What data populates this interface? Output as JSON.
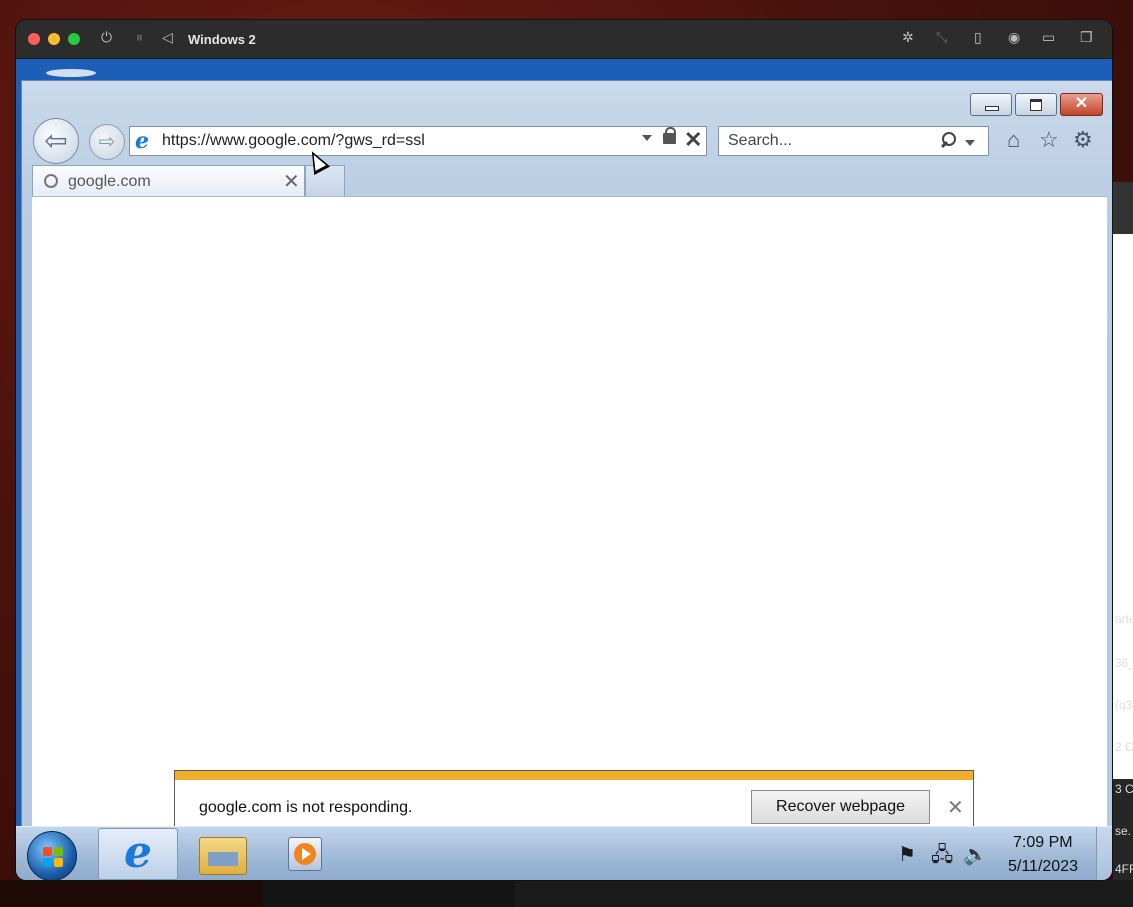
{
  "mac": {
    "title": "Windows 2"
  },
  "ie": {
    "address": "https://www.google.com/?gws_rd=ssl",
    "search_placeholder": "Search...",
    "tab_label": "google.com",
    "tab_close": "✕",
    "notification": {
      "message": "google.com is not responding.",
      "button_label": "Recover webpage",
      "close": "✕"
    }
  },
  "taskbar": {
    "time": "7:09 PM",
    "date": "5/11/2023"
  },
  "background_app": {
    "fragments": [
      "arte",
      "36_",
      "(q3",
      "2 C",
      "3 C",
      "se.",
      "4FR"
    ]
  },
  "colors": {
    "notification_stripe": "#f0ae2c",
    "desktop_blue": "#1b5fb8"
  }
}
